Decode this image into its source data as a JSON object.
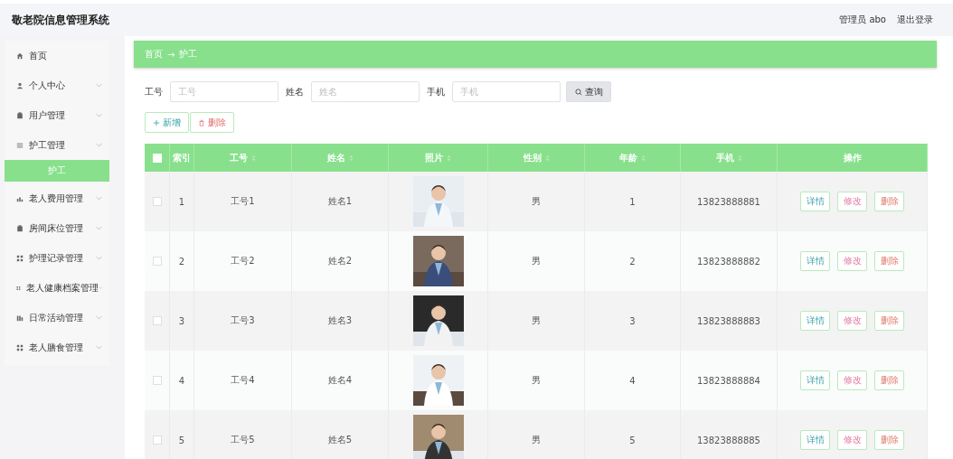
{
  "header": {
    "title": "敬老院信息管理系统",
    "user": "管理员 abo",
    "logout": "退出登录"
  },
  "sidebar": {
    "items": [
      {
        "label": "首页"
      },
      {
        "label": "个人中心"
      },
      {
        "label": "用户管理"
      },
      {
        "label": "护工管理",
        "children": [
          {
            "label": "护工",
            "selected": true
          }
        ]
      },
      {
        "label": "老人费用管理"
      },
      {
        "label": "房间床位管理"
      },
      {
        "label": "护理记录管理"
      },
      {
        "label": "老人健康档案管理"
      },
      {
        "label": "日常活动管理"
      },
      {
        "label": "老人膳食管理"
      }
    ]
  },
  "breadcrumb": {
    "home": "首页",
    "separator": "→",
    "current": "护工"
  },
  "search": {
    "fields": [
      {
        "label": "工号",
        "placeholder": "工号"
      },
      {
        "label": "姓名",
        "placeholder": "姓名"
      },
      {
        "label": "手机",
        "placeholder": "手机"
      }
    ],
    "button": "查询"
  },
  "actions": {
    "add": "新增",
    "delete": "删除"
  },
  "table": {
    "select_all_checked": false,
    "columns": [
      {
        "label": "索引",
        "sortable": false
      },
      {
        "label": "工号",
        "sortable": true
      },
      {
        "label": "姓名",
        "sortable": true
      },
      {
        "label": "照片",
        "sortable": true
      },
      {
        "label": "性别",
        "sortable": true
      },
      {
        "label": "年龄",
        "sortable": true
      },
      {
        "label": "手机",
        "sortable": true
      },
      {
        "label": "操作",
        "sortable": false
      }
    ],
    "rows": [
      {
        "checked": false,
        "index": "1",
        "id": "工号1",
        "name": "姓名1",
        "gender": "男",
        "age": "1",
        "phone": "13823888881",
        "buttons": [
          "详情",
          "修改",
          "删除"
        ]
      },
      {
        "checked": false,
        "index": "2",
        "id": "工号2",
        "name": "姓名2",
        "gender": "男",
        "age": "2",
        "phone": "13823888882",
        "buttons": [
          "详情",
          "修改",
          "删除"
        ]
      },
      {
        "checked": false,
        "index": "3",
        "id": "工号3",
        "name": "姓名3",
        "gender": "男",
        "age": "3",
        "phone": "13823888883",
        "buttons": [
          "详情",
          "修改",
          "删除"
        ]
      },
      {
        "checked": false,
        "index": "4",
        "id": "工号4",
        "name": "姓名4",
        "gender": "男",
        "age": "4",
        "phone": "13823888884",
        "buttons": [
          "详情",
          "修改",
          "删除"
        ]
      },
      {
        "checked": false,
        "index": "5",
        "id": "工号5",
        "name": "姓名5",
        "gender": "男",
        "age": "5",
        "phone": "13823888885",
        "buttons": [
          "详情",
          "修改",
          "删除"
        ]
      }
    ]
  }
}
